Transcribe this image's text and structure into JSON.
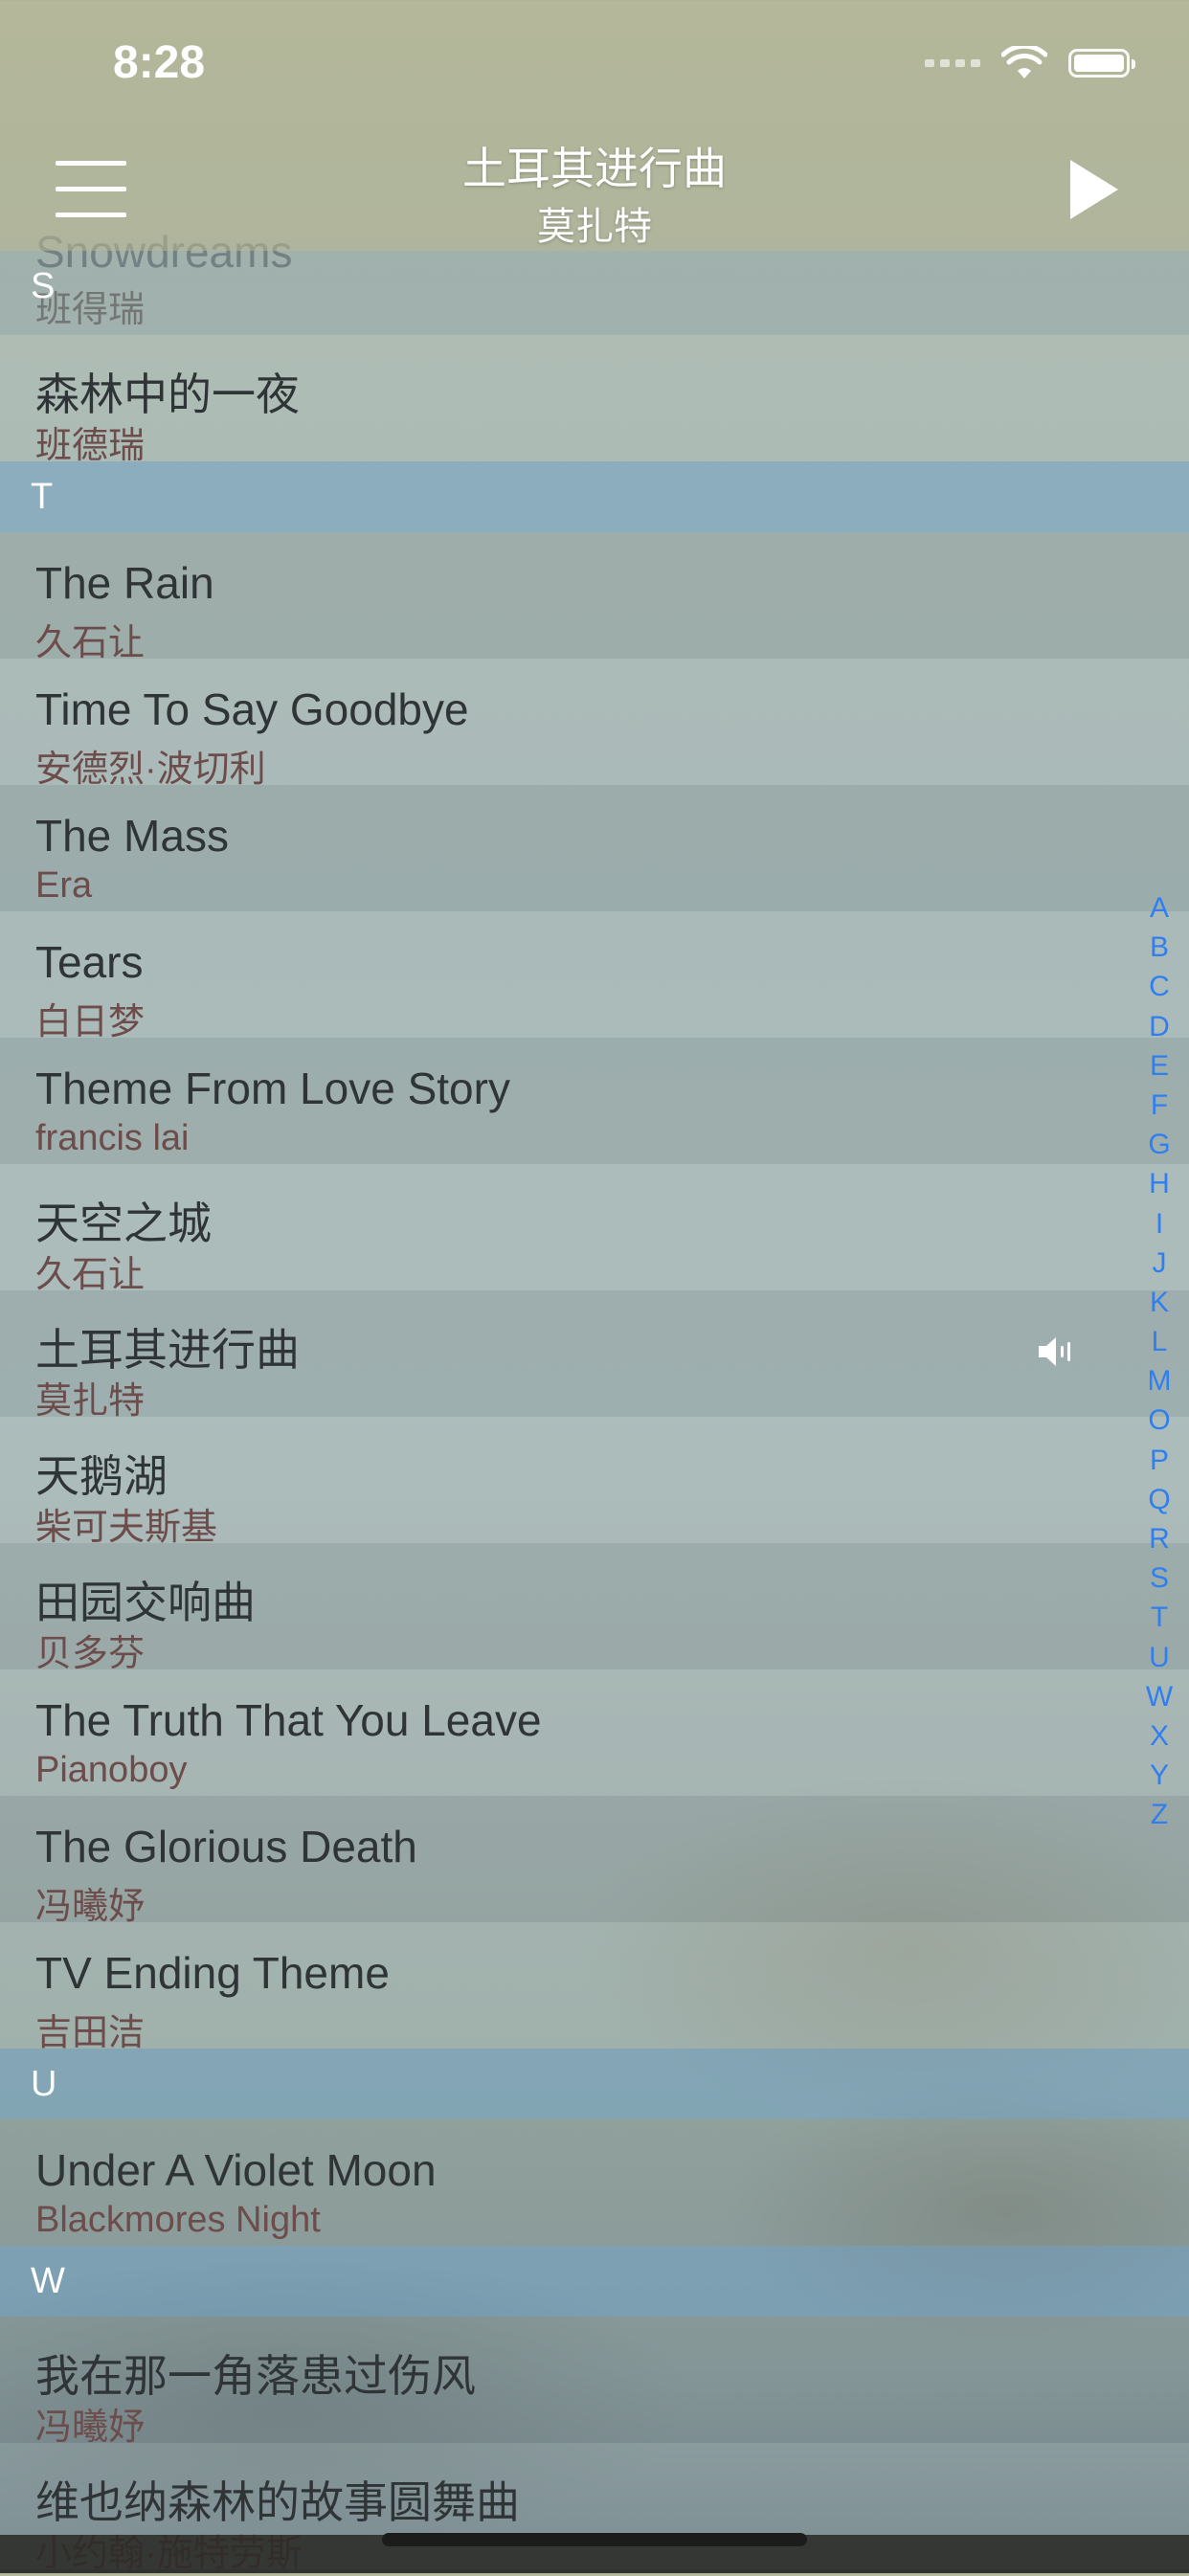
{
  "status": {
    "time": "8:28"
  },
  "nav": {
    "title": "土耳其进行曲",
    "subtitle": "莫扎特"
  },
  "partial_row": {
    "title": "Snowdreams",
    "artist": "班得瑞",
    "section": "S"
  },
  "list": {
    "row_s1": {
      "title": "森林中的一夜",
      "artist": "班德瑞"
    },
    "section_t": "T",
    "t": [
      {
        "title": "The Rain",
        "artist": "久石让"
      },
      {
        "title": "Time To Say Goodbye",
        "artist": "安德烈·波切利"
      },
      {
        "title": "The Mass",
        "artist": "Era"
      },
      {
        "title": "Tears",
        "artist": "白日梦"
      },
      {
        "title": "Theme From Love Story",
        "artist": "francis lai"
      },
      {
        "title": "天空之城",
        "artist": "久石让"
      },
      {
        "title": "土耳其进行曲",
        "artist": "莫扎特",
        "playing": true
      },
      {
        "title": "天鹅湖",
        "artist": "柴可夫斯基"
      },
      {
        "title": "田园交响曲",
        "artist": "贝多芬"
      },
      {
        "title": "The Truth That You Leave",
        "artist": "Pianoboy"
      },
      {
        "title": "The Glorious Death",
        "artist": "冯曦妤"
      },
      {
        "title": "TV Ending Theme",
        "artist": "吉田洁"
      }
    ],
    "section_u": "U",
    "u": [
      {
        "title": "Under A Violet Moon",
        "artist": "Blackmores Night"
      }
    ],
    "section_w": "W",
    "w": [
      {
        "title": "我在那一角落患过伤风",
        "artist": "冯曦妤"
      },
      {
        "title": "维也纳森林的故事圆舞曲",
        "artist": "小约翰·施特劳斯"
      }
    ]
  },
  "index_letters": [
    "A",
    "B",
    "C",
    "D",
    "E",
    "F",
    "G",
    "H",
    "I",
    "J",
    "K",
    "L",
    "M",
    "O",
    "P",
    "Q",
    "R",
    "S",
    "T",
    "U",
    "W",
    "X",
    "Y",
    "Z"
  ],
  "colors": {
    "accent": "#2f7ff0",
    "section_bg": "#7aaacd",
    "artist_text": "#6d4c4c"
  }
}
